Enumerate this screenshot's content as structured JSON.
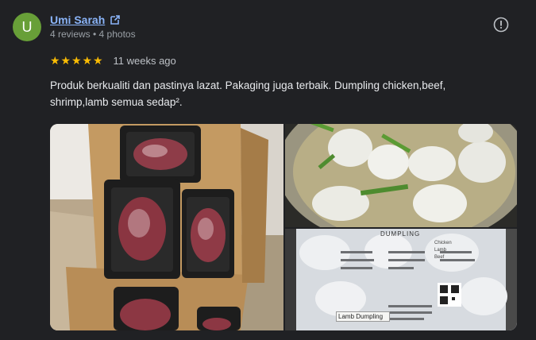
{
  "reviewer": {
    "initial": "U",
    "name": "Umi Sarah",
    "meta": "4 reviews • 4 photos"
  },
  "review": {
    "stars": [
      "★",
      "★",
      "★",
      "★",
      "★"
    ],
    "time": "11 weeks ago",
    "text": "Produk berkualiti dan pastinya lazat. Pakaging juga terbaik. Dumpling chicken,beef, shrimp,lamb semua sedap².",
    "rating": 5
  },
  "photo_texts": {
    "dumpling_header": "DUMPLING",
    "lamb_label": "Lamb Dumpling",
    "options": [
      "Chicken",
      "Lamb",
      "Beef"
    ]
  },
  "colors": {
    "avatar_bg": "#689f38",
    "link": "#8ab4f8",
    "star": "#fbbc04"
  }
}
